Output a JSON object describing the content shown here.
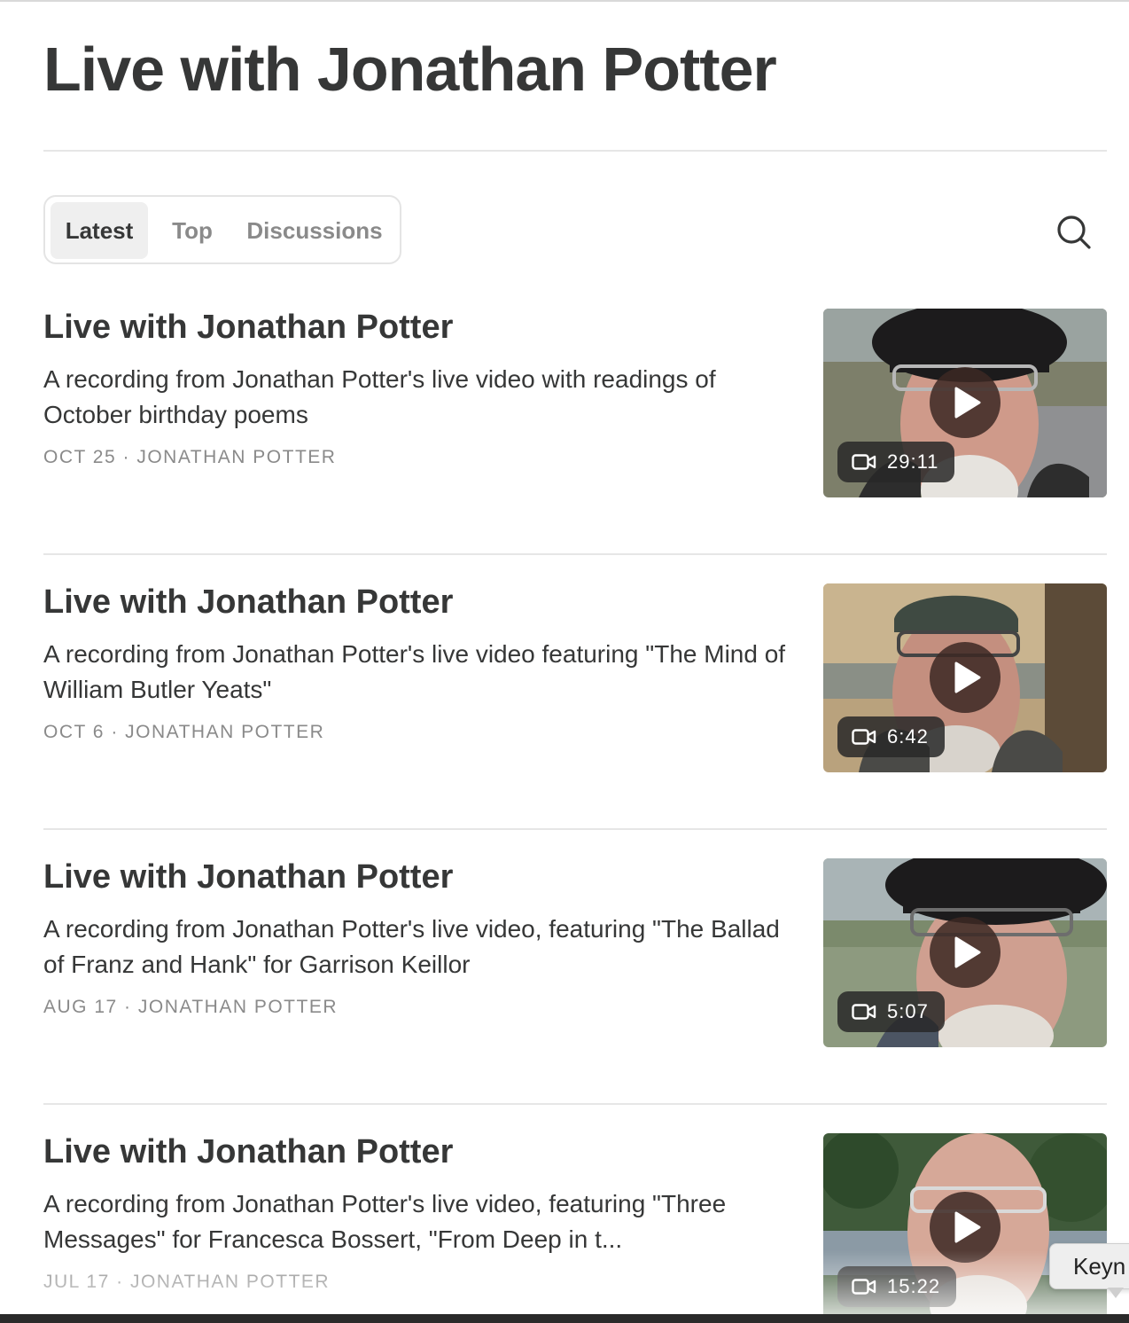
{
  "page": {
    "title": "Live with Jonathan Potter"
  },
  "tabs": [
    {
      "label": "Latest",
      "active": true
    },
    {
      "label": "Top",
      "active": false
    },
    {
      "label": "Discussions",
      "active": false
    }
  ],
  "search": {
    "icon": "search-icon"
  },
  "posts": [
    {
      "title": "Live with Jonathan Potter",
      "description": "A recording from Jonathan Potter's live video with readings of October birthday poems",
      "date": "OCT 25",
      "separator": "·",
      "author": "JONATHAN POTTER",
      "duration": "29:11"
    },
    {
      "title": "Live with Jonathan Potter",
      "description": "A recording from Jonathan Potter's live video featuring \"The Mind of William Butler Yeats\"",
      "date": "OCT 6",
      "separator": "·",
      "author": "JONATHAN POTTER",
      "duration": "6:42"
    },
    {
      "title": "Live with Jonathan Potter",
      "description": "A recording from Jonathan Potter's live video, featuring \"The Ballad of Franz and Hank\" for Garrison Keillor",
      "date": "AUG 17",
      "separator": "·",
      "author": "JONATHAN POTTER",
      "duration": "5:07"
    },
    {
      "title": "Live with Jonathan Potter",
      "description": "A recording from Jonathan Potter's live video, featuring \"Three Messages\" for Francesca Bossert, \"From Deep in t...",
      "date": "JUL 17",
      "separator": "·",
      "author": "JONATHAN POTTER",
      "duration": "15:22"
    }
  ],
  "tooltip": {
    "text": "Keyn"
  },
  "colors": {
    "text": "#363737",
    "muted": "#8a8a8a",
    "divider": "#e6e6e6",
    "active_tab_bg": "#efefef"
  }
}
